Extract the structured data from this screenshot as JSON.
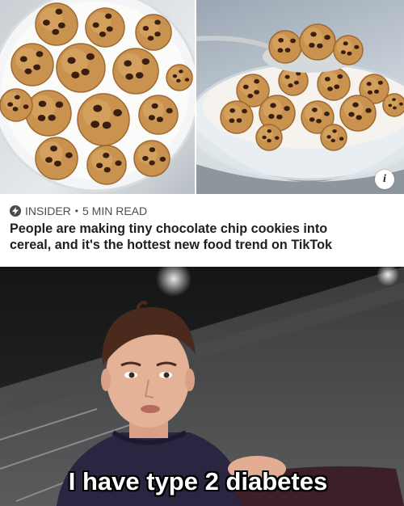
{
  "article": {
    "source": "INSIDER",
    "separator": "•",
    "read_time": "5 MIN READ",
    "headline_line1": "People are making tiny chocolate chip cookies into",
    "headline_line2": "cereal, and it's the hottest new food trend on TikTok"
  },
  "info_badge": "i",
  "caption": "I have type 2 diabetes",
  "icons": {
    "source": "bolt-icon",
    "info": "info-icon"
  },
  "colors": {
    "headline": "#1f1f1f",
    "meta": "#4d4d4d",
    "caption": "#ffffff",
    "caption_outline": "#000000"
  }
}
